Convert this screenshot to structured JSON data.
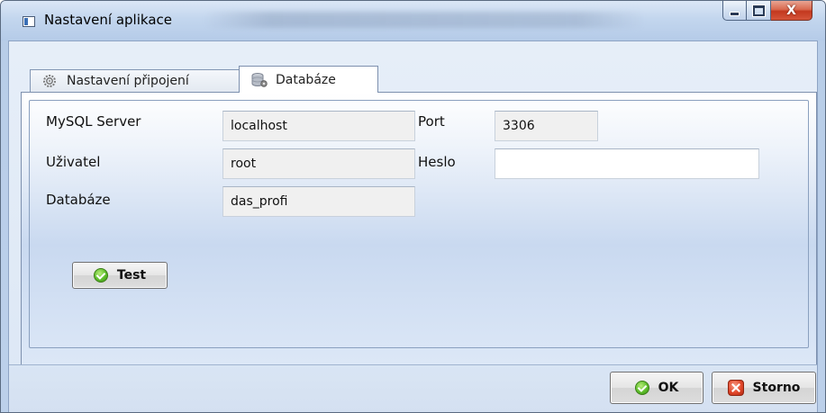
{
  "window": {
    "title": "Nastavení aplikace",
    "minimize_glyph": "",
    "close_glyph": "X"
  },
  "tabs": [
    {
      "label": "Nastavení připojení",
      "icon": "gear-icon",
      "selected": false
    },
    {
      "label": "Databáze",
      "icon": "database-icon",
      "selected": true
    }
  ],
  "form": {
    "server_label": "MySQL Server",
    "server_value": "localhost",
    "port_label": "Port",
    "port_value": "3306",
    "user_label": "Uživatel",
    "user_value": "root",
    "password_label": "Heslo",
    "password_value": "",
    "database_label": "Databáze",
    "database_value": "das_profi"
  },
  "buttons": {
    "test_label": "Test",
    "ok_label": "OK",
    "cancel_label": "Storno"
  },
  "colors": {
    "accent": "#3b6fb6",
    "ok_green": "#5cbd2a",
    "cancel_red": "#e2472a"
  }
}
